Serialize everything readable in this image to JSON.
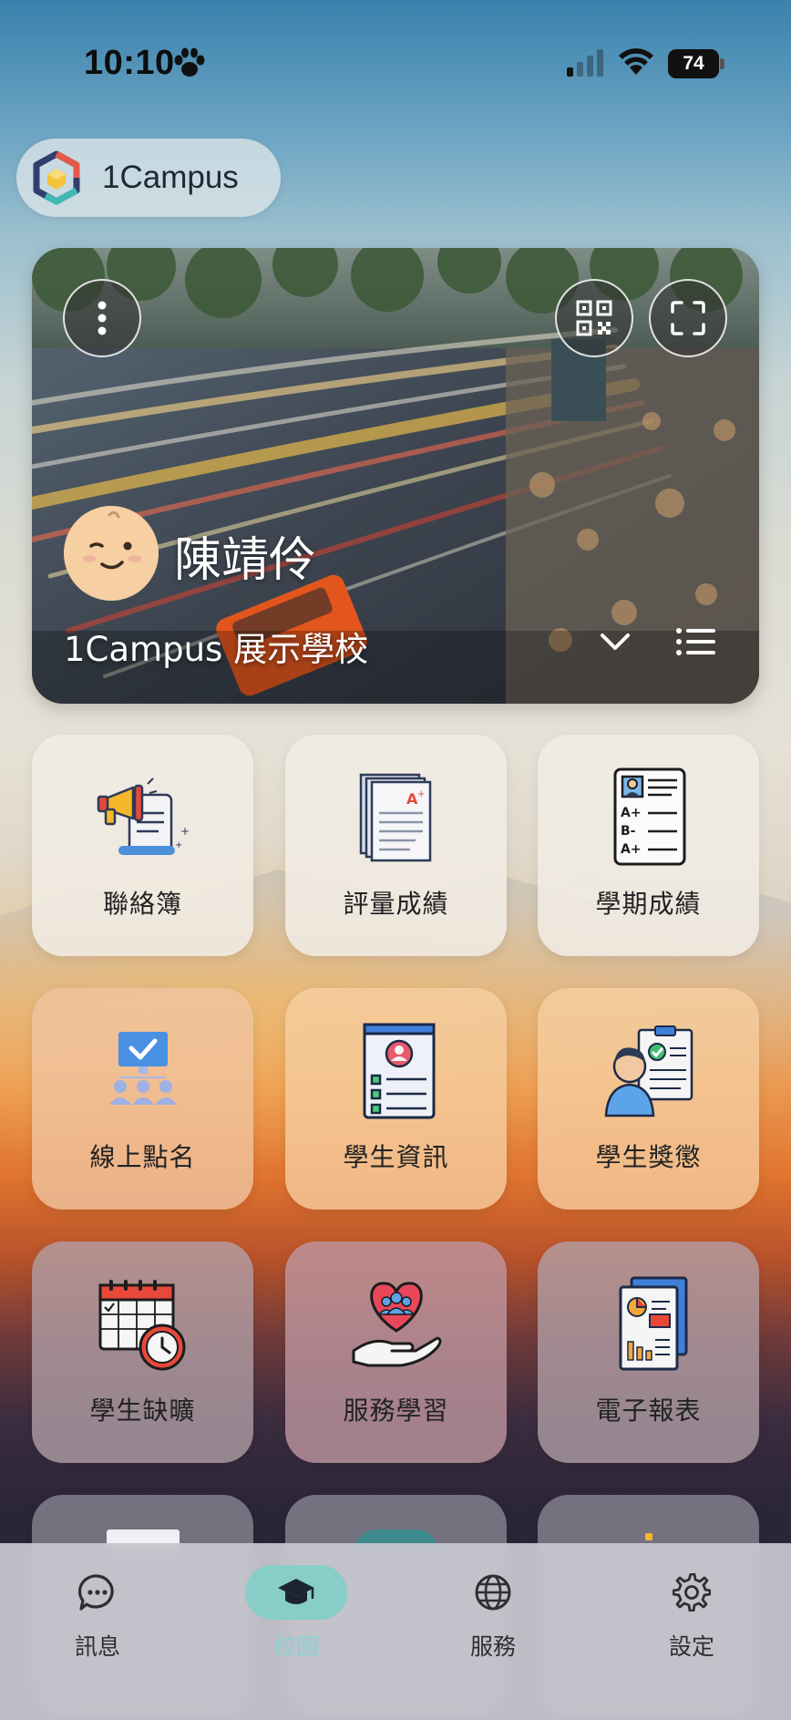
{
  "status_bar": {
    "time": "10:10",
    "battery": "74"
  },
  "app": {
    "name": "1Campus"
  },
  "profile": {
    "user_name": "陳靖伶",
    "school_name": "1Campus 展示學校"
  },
  "tiles": [
    {
      "label": "聯絡簿",
      "icon": "megaphone-notice-icon"
    },
    {
      "label": "評量成績",
      "icon": "graded-papers-icon"
    },
    {
      "label": "學期成績",
      "icon": "report-card-icon"
    },
    {
      "label": "線上點名",
      "icon": "roll-call-icon"
    },
    {
      "label": "學生資訊",
      "icon": "student-info-icon"
    },
    {
      "label": "學生獎懲",
      "icon": "student-merit-icon"
    },
    {
      "label": "學生缺曠",
      "icon": "attendance-calendar-icon"
    },
    {
      "label": "服務學習",
      "icon": "service-heart-icon"
    },
    {
      "label": "電子報表",
      "icon": "e-report-icon"
    }
  ],
  "tabbar": {
    "items": [
      {
        "label": "訊息",
        "icon": "chat-bubble-icon"
      },
      {
        "label": "校園",
        "icon": "graduation-cap-icon"
      },
      {
        "label": "服務",
        "icon": "globe-icon"
      },
      {
        "label": "設定",
        "icon": "gear-icon"
      }
    ],
    "active": "校園",
    "active_color": "#87cdc8"
  }
}
